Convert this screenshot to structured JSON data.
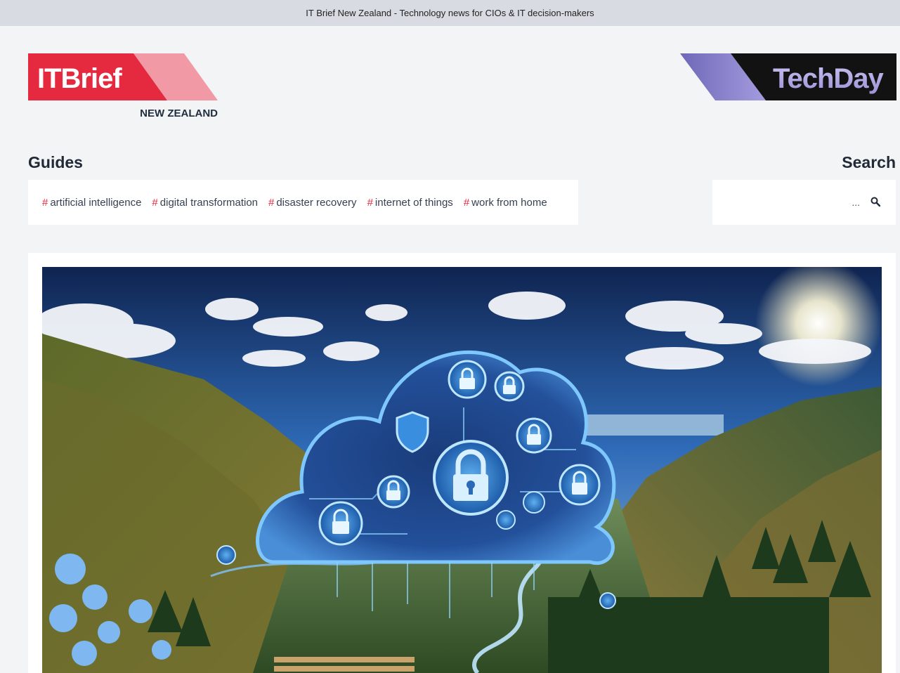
{
  "window": {
    "title": "IT Brief New Zealand - Technology news for CIOs & IT decision-makers"
  },
  "brand": {
    "logo_text_it": "IT",
    "logo_text_brief": "Brief",
    "region": "NEW ZEALAND",
    "partner_logo_text": "TechDay",
    "colors": {
      "brand_red": "#e5293f",
      "brand_pink": "#f19aa6",
      "partner_purple": "#8c84c9",
      "partner_dark": "#121212"
    }
  },
  "guides": {
    "heading": "Guides",
    "hash_symbol": "#",
    "tags": [
      "artificial intelligence",
      "digital transformation",
      "disaster recovery",
      "internet of things",
      "work from home"
    ]
  },
  "search": {
    "heading": "Search",
    "placeholder": "...",
    "icon": "search-icon"
  },
  "article": {
    "image_icon": "cloud-padlock-landscape-illustration"
  }
}
